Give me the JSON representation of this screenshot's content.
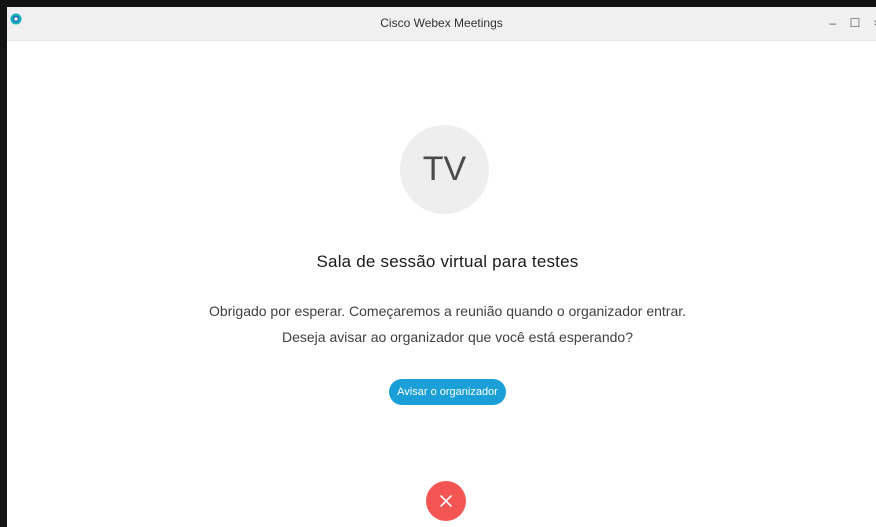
{
  "window": {
    "title": "Cisco Webex Meetings",
    "minimize_glyph": "–",
    "maximize_glyph": "☐",
    "close_glyph": "×"
  },
  "meeting": {
    "avatar_initials": "TV",
    "title": "Sala de sessão virtual para testes",
    "message_line1": "Obrigado por esperar. Começaremos a reunião quando o organizador entrar.",
    "message_line2": "Deseja avisar ao organizador que você está esperando?"
  },
  "actions": {
    "notify_label": "Avisar o organizador",
    "leave_icon": "close-icon"
  },
  "colors": {
    "accent": "#1a9fd8",
    "leave": "#f25552",
    "logo_outer": "#0db0b8",
    "logo_inner": "#2d6fb7"
  }
}
